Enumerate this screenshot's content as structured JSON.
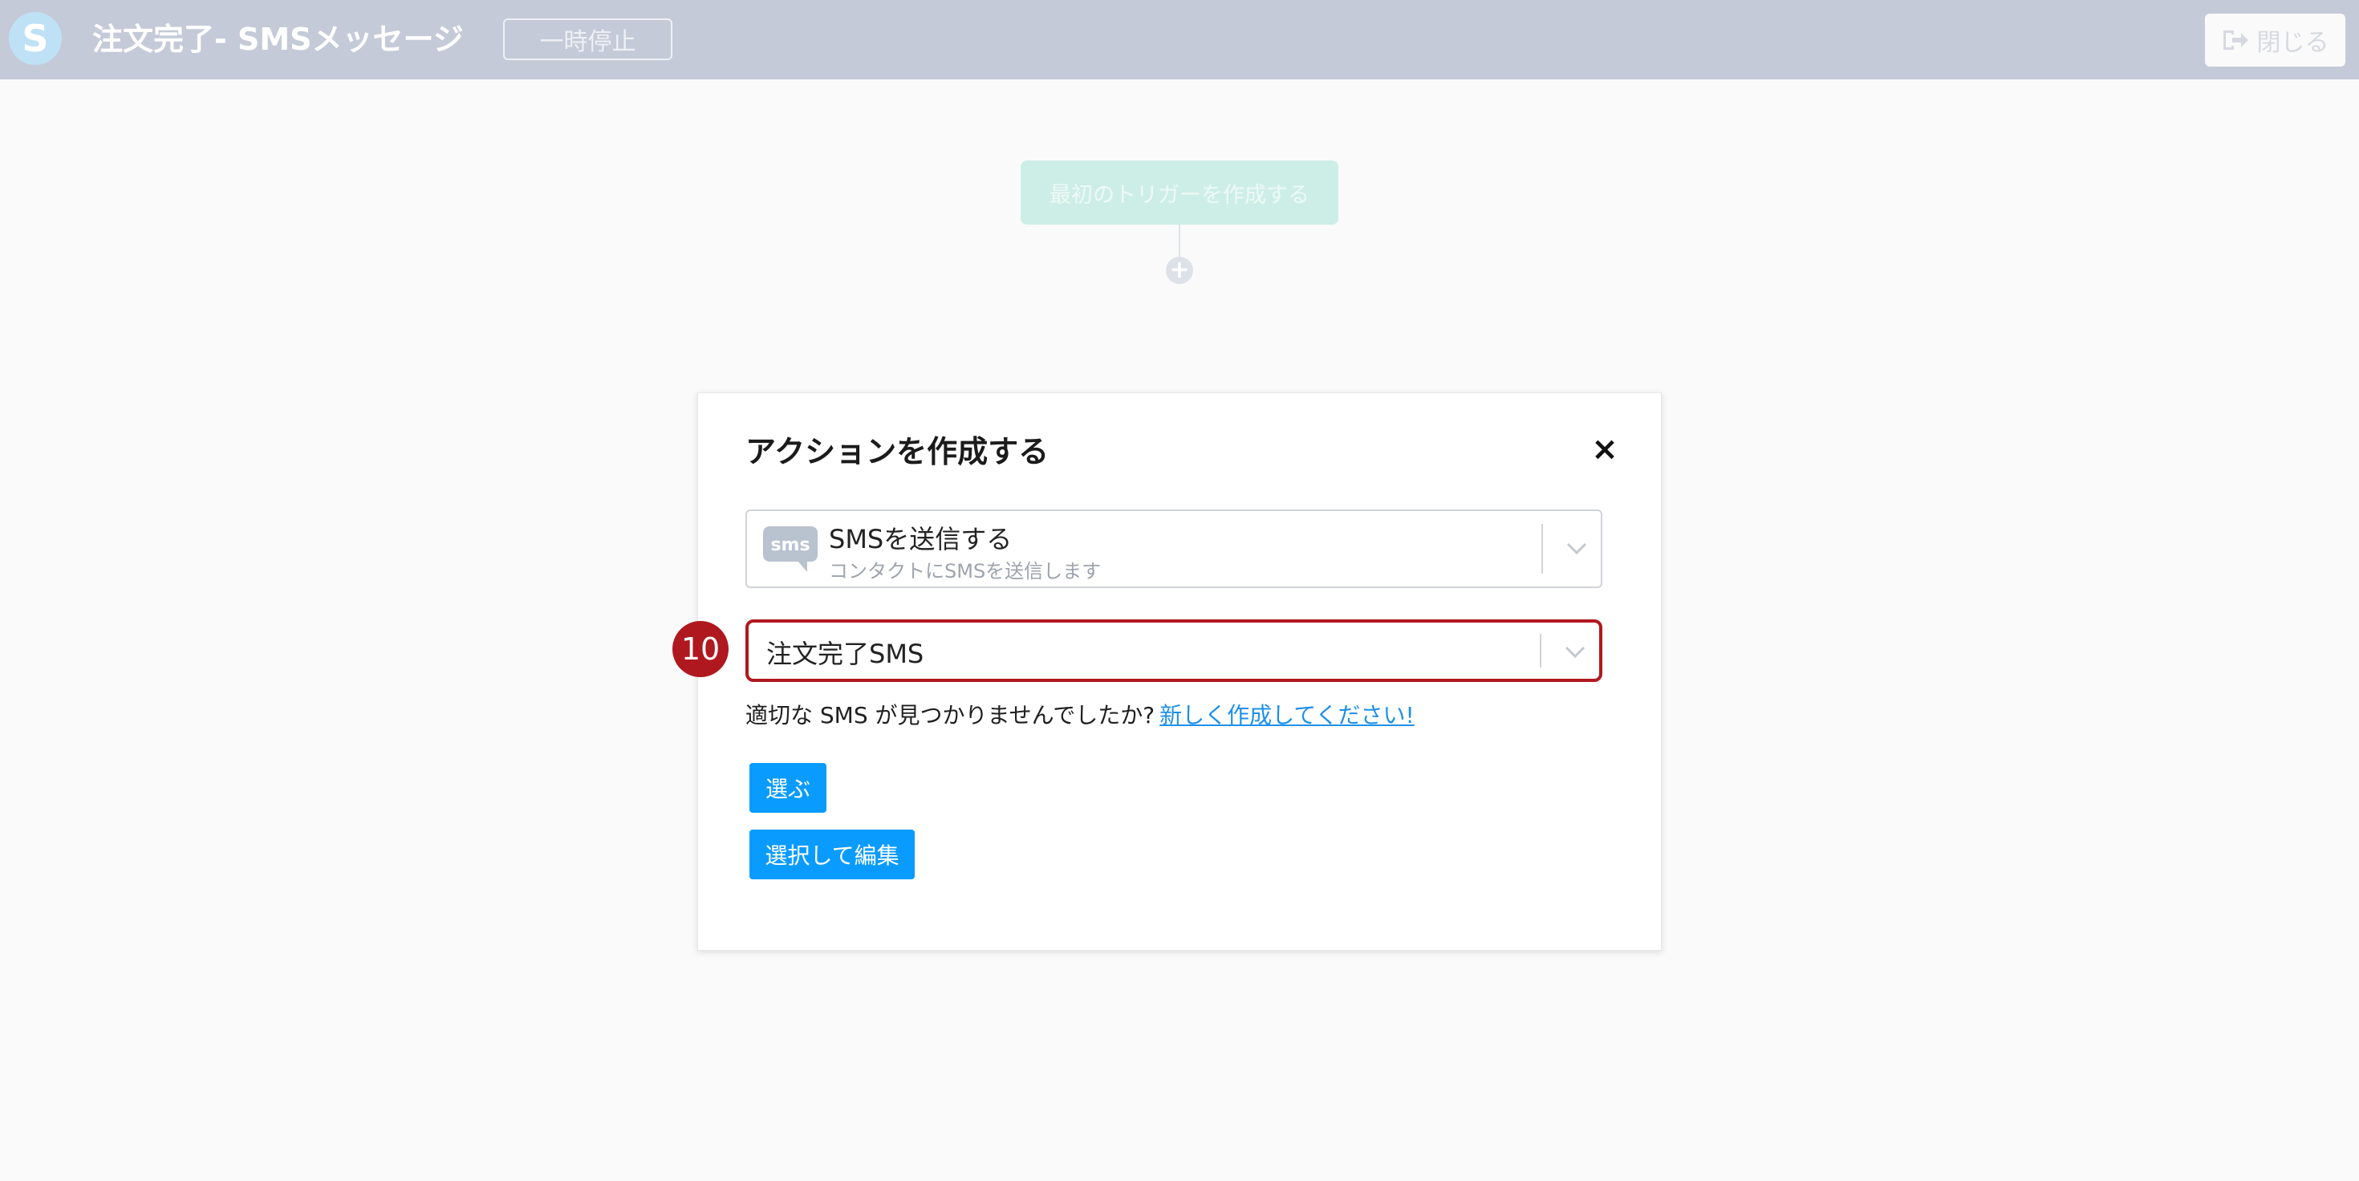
{
  "header": {
    "logo_letter": "S",
    "title": "注文完了- SMSメッセージ",
    "pause_label": "一時停止",
    "close_label": "閉じる",
    "close_icon": "sign-out-icon"
  },
  "canvas": {
    "trigger_label": "最初のトリガーを作成する",
    "add_icon": "plus-icon"
  },
  "modal": {
    "title": "アクションを作成する",
    "close_glyph": "×",
    "action_select": {
      "icon_label": "sms",
      "title": "SMSを送信する",
      "subtitle": "コンタクトにSMSを送信します"
    },
    "sms_select": {
      "value": "注文完了SMS"
    },
    "hint_text": "適切な SMS が見つかりませんでしたか?",
    "hint_link": "新しく作成してください!",
    "select_button": "選ぶ",
    "select_edit_button": "選択して編集"
  },
  "annotation": {
    "step_number": "10",
    "highlight_color": "#b0181f"
  },
  "colors": {
    "header_bg": "#c5cad8",
    "primary_button": "#0a9bff",
    "link": "#1e90e8"
  }
}
